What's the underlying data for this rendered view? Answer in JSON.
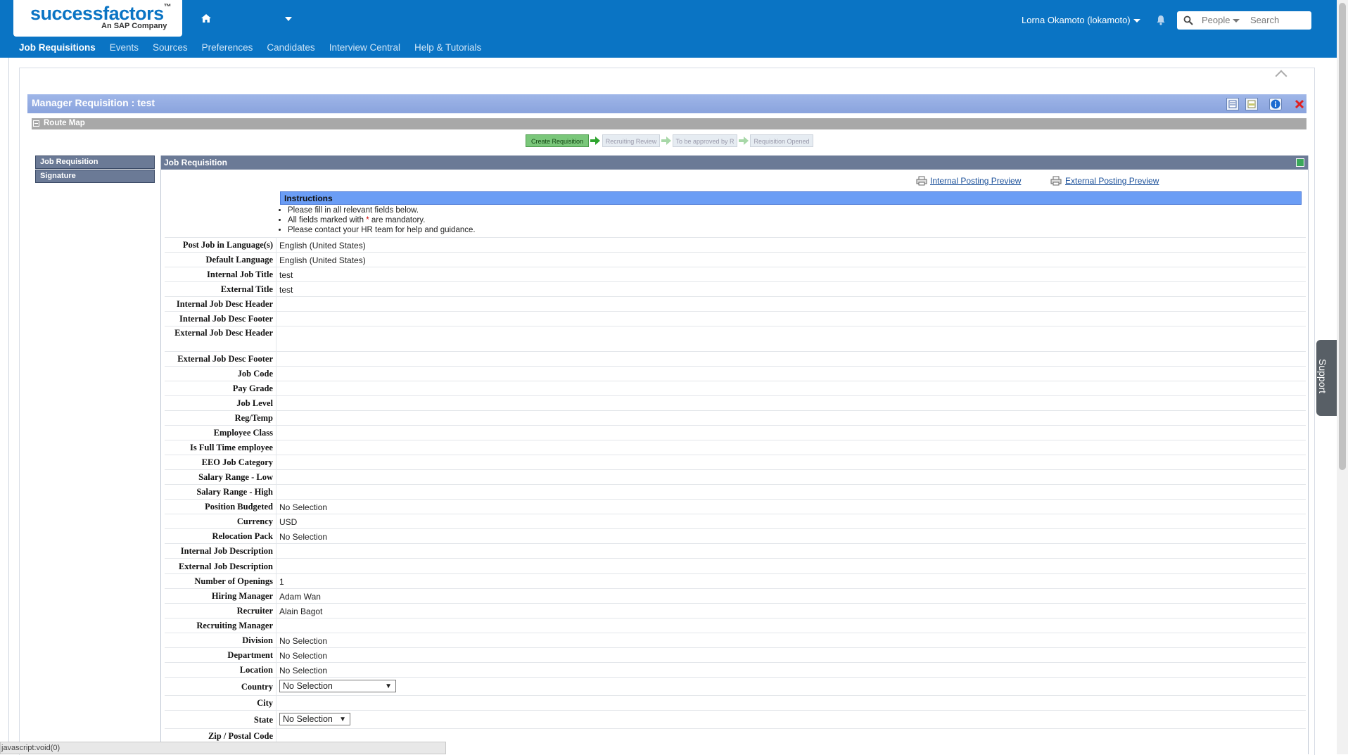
{
  "header": {
    "logo_main": "successfactors",
    "logo_tm": "™",
    "logo_sub": "An SAP Company",
    "user_name": "Lorna Okamoto (lokamoto)",
    "search_scope": "People",
    "search_placeholder": "Search",
    "brand_color": "#0a74c4"
  },
  "nav": {
    "items": [
      {
        "label": "Job Requisitions"
      },
      {
        "label": "Events"
      },
      {
        "label": "Sources"
      },
      {
        "label": "Preferences"
      },
      {
        "label": "Candidates"
      },
      {
        "label": "Interview Central"
      },
      {
        "label": "Help & Tutorials"
      }
    ]
  },
  "page": {
    "title": "Manager Requisition : test",
    "route_map_label": "Route Map",
    "steps": [
      {
        "label": "Create Requisition"
      },
      {
        "label": "Recruiting Review"
      },
      {
        "label": "To be approved by R"
      },
      {
        "label": "Requisition Opened"
      }
    ],
    "side_tabs": [
      {
        "label": "Job Requisition"
      },
      {
        "label": "Signature"
      }
    ],
    "section_title": "Job Requisition",
    "internal_preview": "Internal Posting Preview",
    "external_preview": "External Posting Preview"
  },
  "instructions": {
    "title": "Instructions",
    "line1": "Please fill in all relevant fields below.",
    "line2_pre": "All fields marked with",
    "line2_star": "*",
    "line2_post": "are mandatory.",
    "line3": "Please contact your HR team for help and guidance."
  },
  "fields": [
    {
      "label": "Post Job in Language(s)",
      "value": "English (United States)"
    },
    {
      "label": "Default Language",
      "value": "English (United States)"
    },
    {
      "label": "Internal Job Title",
      "value": "test"
    },
    {
      "label": "External Title",
      "value": "test"
    },
    {
      "label": "Internal Job Desc Header",
      "value": ""
    },
    {
      "label": "Internal Job Desc Footer",
      "value": ""
    },
    {
      "label": "External Job Desc Header",
      "value": ""
    },
    {
      "label": "External Job Desc Footer",
      "value": ""
    },
    {
      "label": "Job Code",
      "value": ""
    },
    {
      "label": "Pay Grade",
      "value": ""
    },
    {
      "label": "Job Level",
      "value": ""
    },
    {
      "label": "Reg/Temp",
      "value": ""
    },
    {
      "label": "Employee Class",
      "value": ""
    },
    {
      "label": "Is Full Time employee",
      "value": ""
    },
    {
      "label": "EEO Job Category",
      "value": ""
    },
    {
      "label": "Salary Range - Low",
      "value": ""
    },
    {
      "label": "Salary Range - High",
      "value": ""
    },
    {
      "label": "Position Budgeted",
      "value": "No Selection"
    },
    {
      "label": "Currency",
      "value": "USD"
    },
    {
      "label": "Relocation Pack",
      "value": "No Selection"
    },
    {
      "label": "Internal Job Description",
      "value": ""
    },
    {
      "label": "External Job Description",
      "value": ""
    },
    {
      "label": "Number of Openings",
      "value": "1"
    },
    {
      "label": "Hiring Manager",
      "value": "Adam Wan"
    },
    {
      "label": "Recruiter",
      "value": "Alain Bagot"
    },
    {
      "label": "Recruiting Manager",
      "value": ""
    },
    {
      "label": "Division",
      "value": "No Selection"
    },
    {
      "label": "Department",
      "value": "No Selection"
    },
    {
      "label": "Location",
      "value": "No Selection"
    },
    {
      "label": "Country",
      "value": "No Selection",
      "select": true
    },
    {
      "label": "City",
      "value": ""
    },
    {
      "label": "State",
      "value": "No Selection",
      "select": true
    },
    {
      "label": "Zip / Postal Code",
      "value": ""
    }
  ],
  "support_label": "Support",
  "status_text": "javascript:void(0)"
}
